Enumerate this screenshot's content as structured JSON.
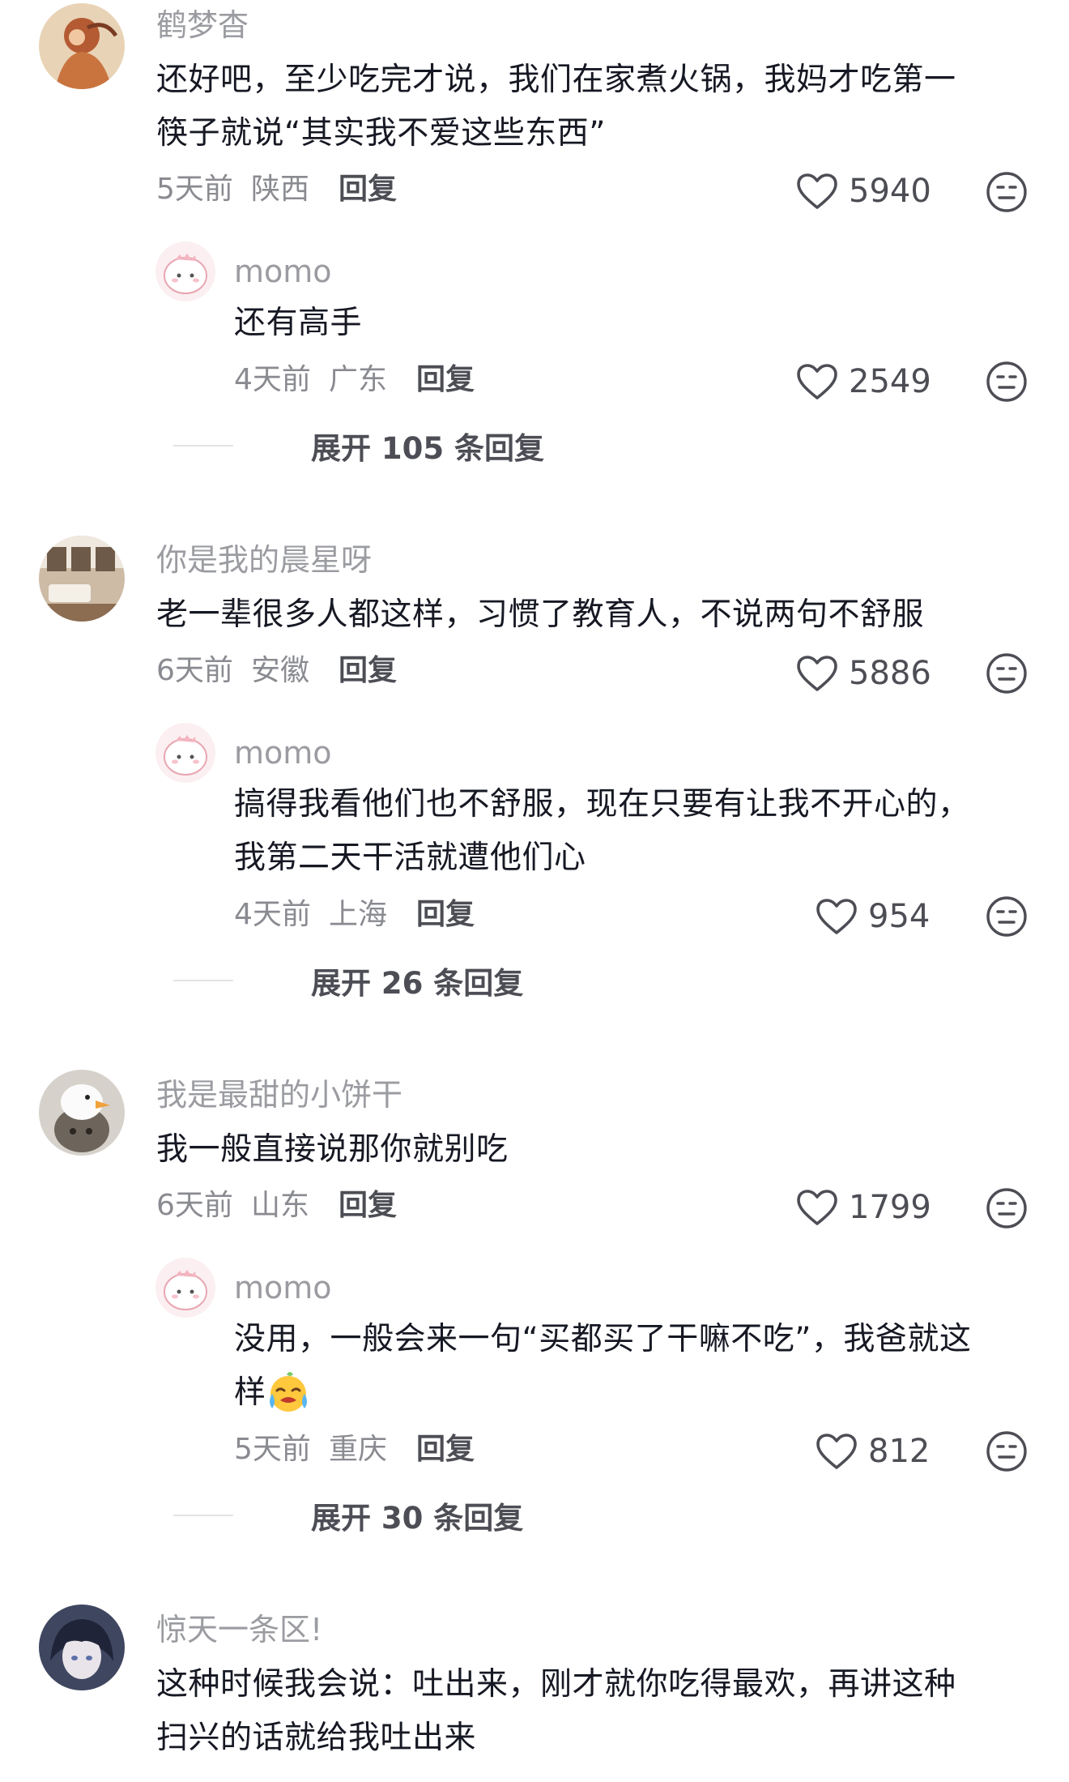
{
  "comments": [
    {
      "username": "鹤梦杳",
      "lines": [
        "还好吧，至少吃完才说，我们在家煮火锅，我妈才吃第一",
        "筷子就说“其实我不爱这些东西”"
      ],
      "time": "5天前",
      "location": "陕西",
      "reply_label": "回复",
      "likes": "5940",
      "reply": {
        "username": "momo",
        "lines": [
          "还有高手"
        ],
        "time": "4天前",
        "location": "广东",
        "reply_label": "回复",
        "likes": "2549"
      },
      "expand_label": "展开 105 条回复"
    },
    {
      "username": "你是我的晨星呀",
      "lines": [
        "老一辈很多人都这样，习惯了教育人，不说两句不舒服"
      ],
      "time": "6天前",
      "location": "安徽",
      "reply_label": "回复",
      "likes": "5886",
      "reply": {
        "username": "momo",
        "lines": [
          "搞得我看他们也不舒服，现在只要有让我不开心的，",
          "我第二天干活就遭他们心"
        ],
        "time": "4天前",
        "location": "上海",
        "reply_label": "回复",
        "likes": "954"
      },
      "expand_label": "展开 26 条回复"
    },
    {
      "username": "我是最甜的小饼干",
      "lines": [
        "我一般直接说那你就别吃"
      ],
      "time": "6天前",
      "location": "山东",
      "reply_label": "回复",
      "likes": "1799",
      "reply": {
        "username": "momo",
        "lines": [
          "没用，一般会来一句“买都买了干嘛不吃”，我爸就这",
          "样"
        ],
        "emoji": "crying-face-emoji",
        "time": "5天前",
        "location": "重庆",
        "reply_label": "回复",
        "likes": "812"
      },
      "expand_label": "展开 30 条回复"
    },
    {
      "username": "惊天一条区!",
      "lines": [
        "这种时候我会说：吐出来，刚才就你吃得最欢，再讲这种",
        "扫兴的话就给我吐出来"
      ]
    }
  ],
  "icons": {
    "like": "heart-outline-icon",
    "dislike": "neutral-face-icon"
  },
  "colors": {
    "username": "#9b9ca1",
    "text": "#161823",
    "meta": "#8a8b91",
    "action": "#4d4e55"
  }
}
